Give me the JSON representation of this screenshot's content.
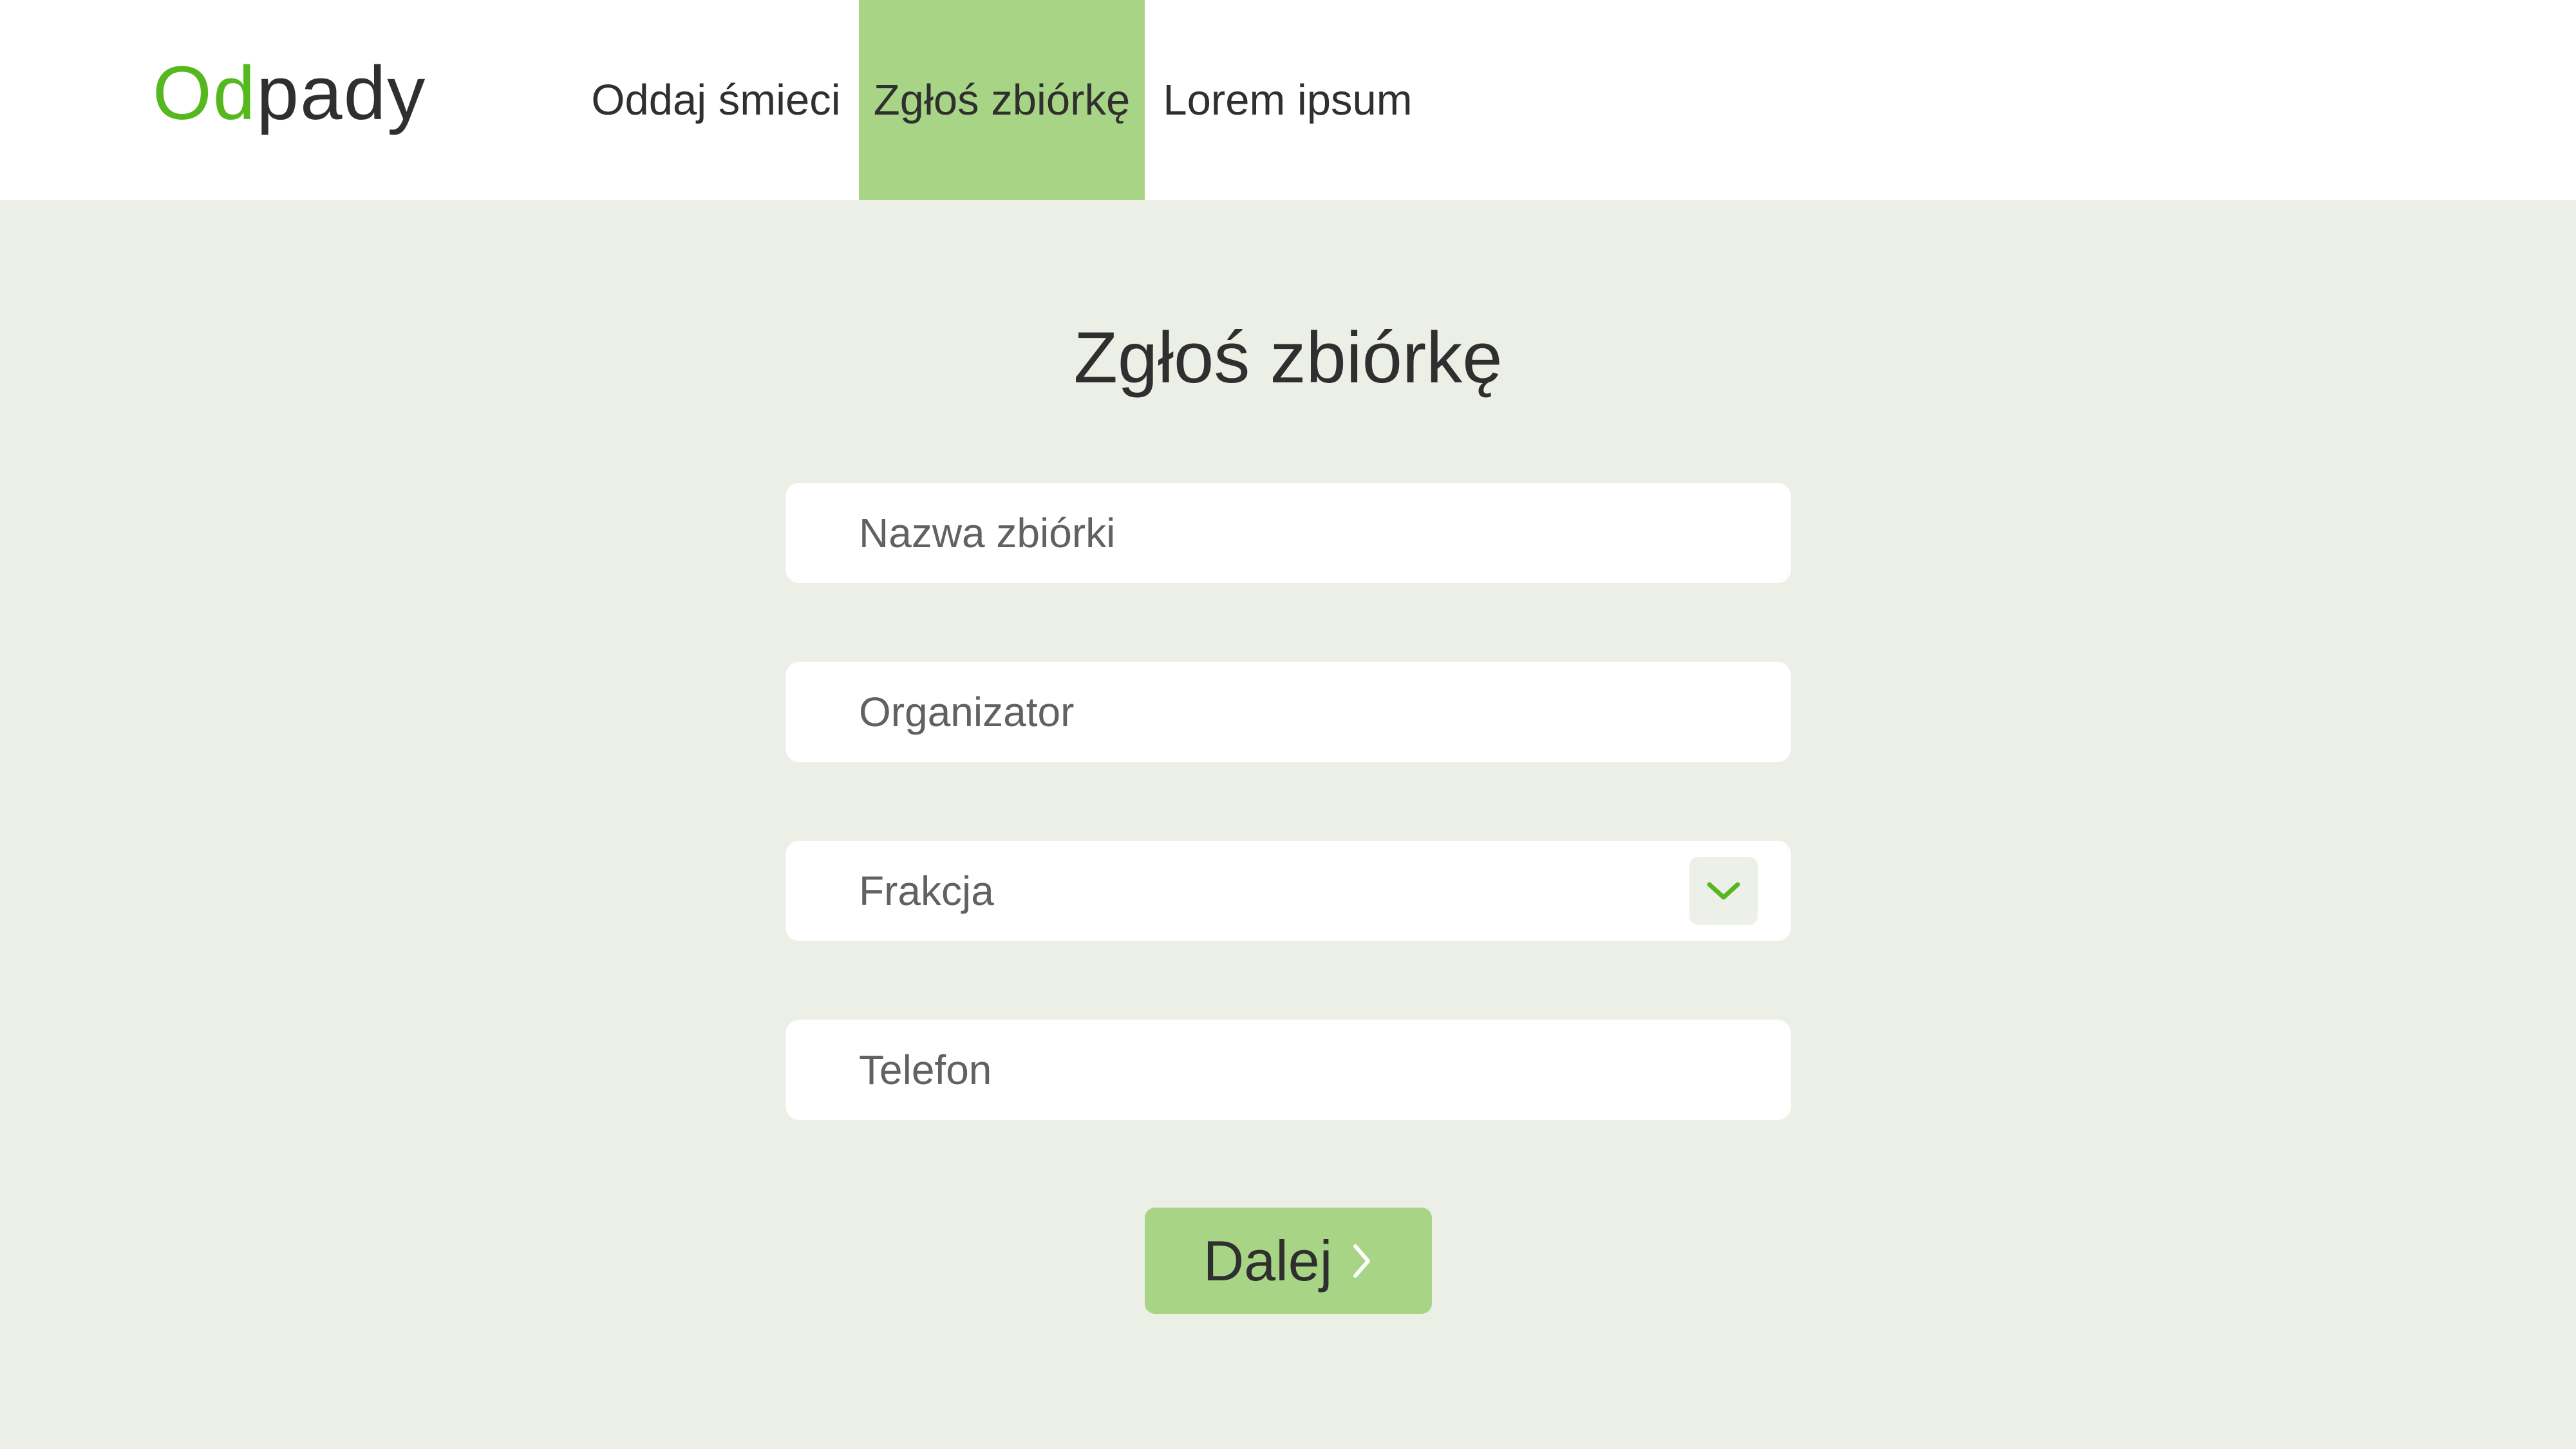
{
  "header": {
    "logo": {
      "accent_text": "Od",
      "rest_text": "pady"
    },
    "nav": [
      {
        "label": "Oddaj śmieci",
        "active": false
      },
      {
        "label": "Zgłoś zbiórkę",
        "active": true
      },
      {
        "label": "Lorem ipsum",
        "active": false
      }
    ]
  },
  "form": {
    "title": "Zgłoś zbiórkę",
    "fields": {
      "name": {
        "placeholder": "Nazwa zbiórki",
        "value": ""
      },
      "organizer": {
        "placeholder": "Organizator",
        "value": ""
      },
      "fraction": {
        "selected": "Frakcja",
        "icon": "chevron-down-icon"
      },
      "phone": {
        "placeholder": "Telefon",
        "value": ""
      }
    },
    "submit": {
      "label": "Dalej",
      "icon": "chevron-right-icon"
    }
  },
  "colors": {
    "accent": "#55b81e",
    "active_nav_bg": "#a8d585",
    "button_bg": "#a8d585",
    "page_bg": "#ecefe6",
    "text": "#2f2f2f",
    "placeholder": "#616161"
  }
}
